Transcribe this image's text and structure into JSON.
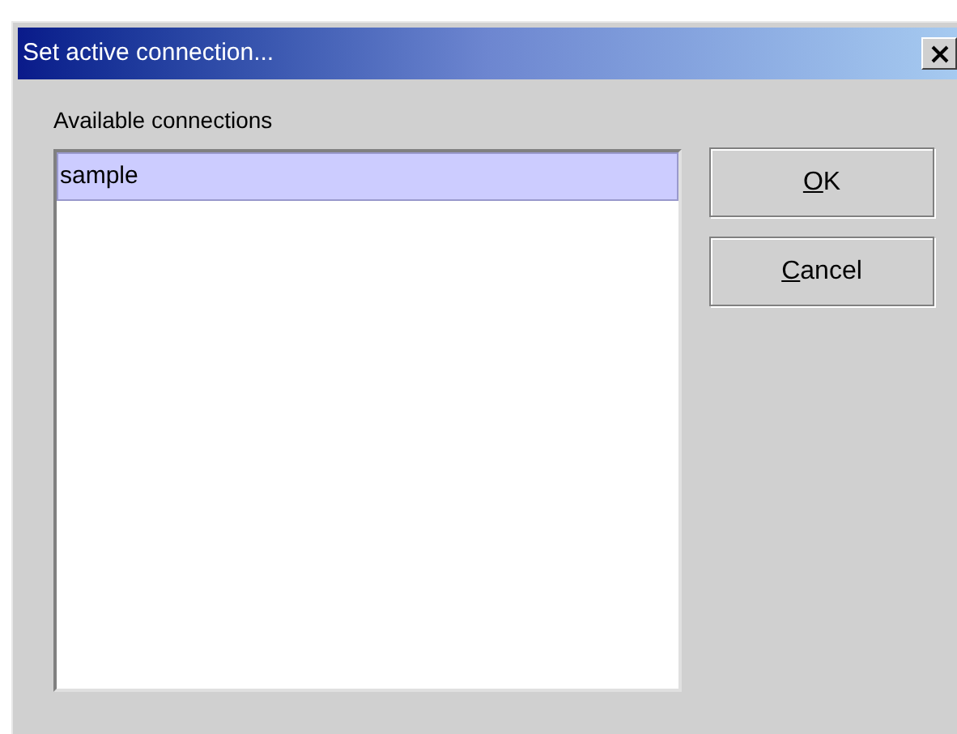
{
  "window": {
    "title": "Set active connection..."
  },
  "list_label": "Available connections",
  "connections": [
    {
      "name": "sample",
      "selected": true
    }
  ],
  "buttons": [
    {
      "parts": [
        {
          "text": "O",
          "underlined": true
        },
        {
          "text": "K",
          "underlined": false
        }
      ]
    },
    {
      "parts": [
        {
          "text": "C",
          "underlined": true
        },
        {
          "text": "ancel",
          "underlined": false
        }
      ]
    }
  ]
}
